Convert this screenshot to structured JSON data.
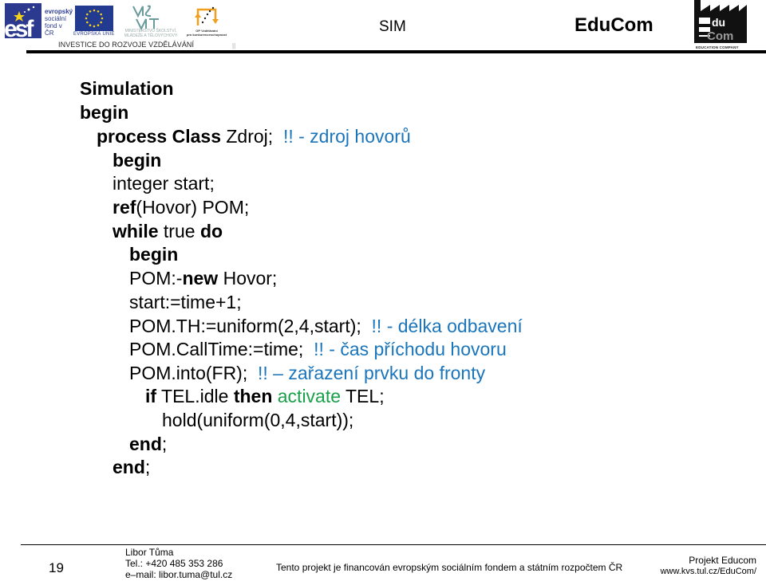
{
  "header": {
    "esf_logo_text": "esf",
    "esf_subtext": [
      "evropský",
      "sociální",
      "fond v ČR"
    ],
    "eu_label": "EVROPSKÁ UNIE",
    "msmt_label": [
      "MINISTERSTVO ŠKOLSTVÍ,",
      "MLÁDEŽE A TĚLOVÝCHOVY"
    ],
    "op_label": [
      "OP Vzdělávání",
      "pro konkurenceschopnost"
    ],
    "investice": "INVESTICE DO ROZVOJE VZDĚLÁVÁNÍ",
    "small_mark": "||",
    "course": "SIM",
    "brand": "EduCom",
    "educom_logo": {
      "top": "du",
      "bottom": "Com",
      "caption": "EDUCATION COMPANY"
    }
  },
  "code": [
    {
      "segments": [
        {
          "t": "Simulation",
          "s": "kw"
        }
      ]
    },
    {
      "segments": [
        {
          "t": "begin",
          "s": "kw"
        }
      ]
    },
    {
      "segments": [
        {
          "t": "process Class",
          "s": "kw"
        },
        {
          "t": " Zdroj;  ",
          "s": ""
        },
        {
          "t": "!! - zdroj hovorů",
          "s": "cm"
        }
      ]
    },
    {
      "segments": [
        {
          "t": "begin",
          "s": "kw"
        }
      ]
    },
    {
      "segments": [
        {
          "t": "integer start;",
          "s": ""
        }
      ]
    },
    {
      "segments": [
        {
          "t": "ref",
          "s": "kw"
        },
        {
          "t": "(Hovor) POM;",
          "s": ""
        }
      ]
    },
    {
      "segments": [
        {
          "t": "while",
          "s": "kw"
        },
        {
          "t": " true ",
          "s": ""
        },
        {
          "t": "do",
          "s": "kw"
        }
      ]
    },
    {
      "segments": [
        {
          "t": "begin",
          "s": "kw"
        }
      ]
    },
    {
      "segments": [
        {
          "t": "POM:-",
          "s": ""
        },
        {
          "t": "new",
          "s": "kw"
        },
        {
          "t": " Hovor;",
          "s": ""
        }
      ]
    },
    {
      "segments": [
        {
          "t": "start:=time+1;",
          "s": ""
        }
      ]
    },
    {
      "segments": [
        {
          "t": "POM.TH:=uniform(2,4,start);  ",
          "s": ""
        },
        {
          "t": "!! - délka odbavení",
          "s": "cm"
        }
      ]
    },
    {
      "segments": [
        {
          "t": "POM.CallTime:=time;  ",
          "s": ""
        },
        {
          "t": "!! - čas příchodu hovoru",
          "s": "cm"
        }
      ]
    },
    {
      "segments": [
        {
          "t": "POM.into(FR);  ",
          "s": ""
        },
        {
          "t": "!! – zařazení prvku do fronty",
          "s": "cm"
        }
      ]
    },
    {
      "segments": [
        {
          "t": "if",
          "s": "kw"
        },
        {
          "t": " TEL.idle ",
          "s": ""
        },
        {
          "t": "then",
          "s": "kw"
        },
        {
          "t": " ",
          "s": ""
        },
        {
          "t": "activate",
          "s": "act"
        },
        {
          "t": " TEL;",
          "s": ""
        }
      ]
    },
    {
      "segments": [
        {
          "t": "hold(uniform(0,4,start));",
          "s": ""
        }
      ]
    },
    {
      "segments": [
        {
          "t": "end",
          "s": "kw"
        },
        {
          "t": ";",
          "s": ""
        }
      ]
    },
    {
      "segments": [
        {
          "t": "end",
          "s": "kw"
        },
        {
          "t": ";",
          "s": ""
        }
      ]
    }
  ],
  "colors": {
    "comment": "#1b75bb",
    "activate": "#1aa04a",
    "esf_blue": "#2b3a8f"
  },
  "footer": {
    "page_number": "19",
    "author_name": "Libor Tůma",
    "author_phone": "Tel.: +420 485 353 286",
    "author_email": "e–mail: libor.tuma@tul.cz",
    "funding": "Tento projekt je financován evropským sociálním fondem a státním rozpočtem ČR",
    "project_name": "Projekt Educom",
    "project_url": "www.kvs.tul.cz/EduCom/"
  }
}
